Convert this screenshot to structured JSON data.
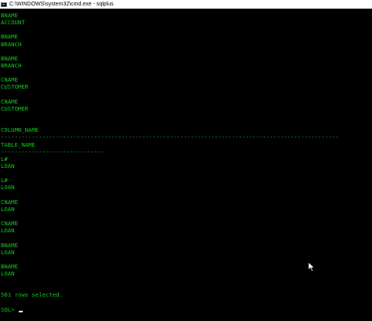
{
  "window": {
    "title": "C:\\WINDOWS\\system32\\cmd.exe - sqlplus"
  },
  "console": {
    "lines": [
      "BNAME",
      "ACCOUNT",
      "",
      "BNAME",
      "BRANCH",
      "",
      "BNAME",
      "BRANCH",
      "",
      "CNAME",
      "CUSTOMER",
      "",
      "CNAME",
      "CUSTOMER",
      "",
      "",
      "COLUMN_NAME",
      "--------------------------------------------------------------------------------------------------",
      "TABLE_NAME",
      "------------------------------",
      "L#",
      "LOAN",
      "",
      "L#",
      "LOAN",
      "",
      "CNAME",
      "LOAN",
      "",
      "CNAME",
      "LOAN",
      "",
      "BNAME",
      "LOAN",
      "",
      "BNAME",
      "LOAN",
      "",
      "",
      "501 rows selected.",
      ""
    ],
    "prompt": "SQL>"
  },
  "colors": {
    "text": "#13c51e",
    "background": "#000000",
    "titlebar": "#ffffff"
  }
}
